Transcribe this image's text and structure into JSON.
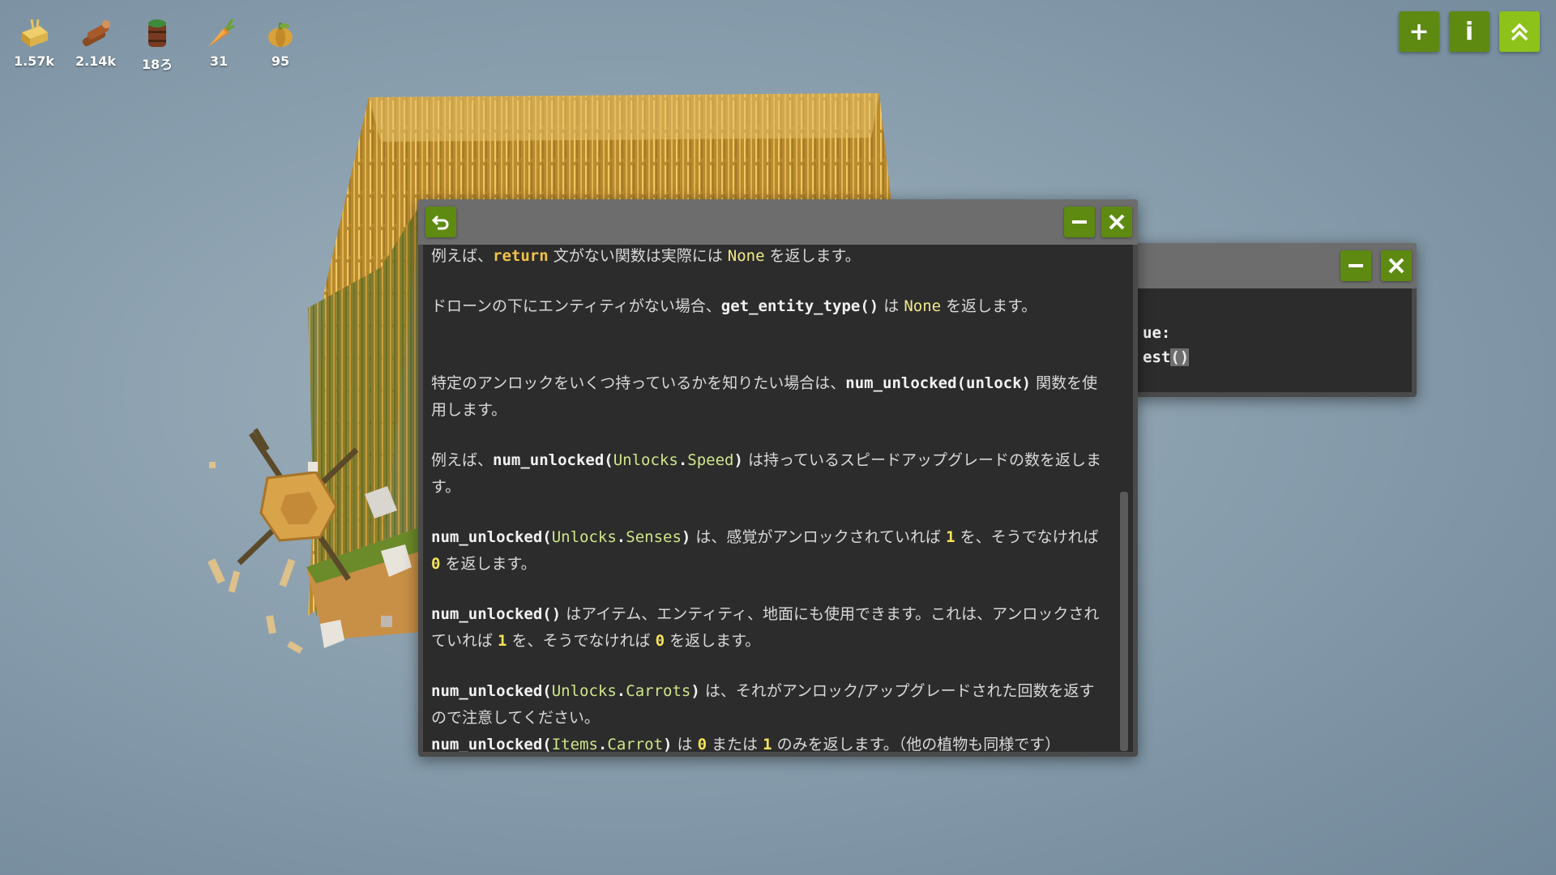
{
  "resources": [
    {
      "icon": "hay-icon",
      "count": "1.57k"
    },
    {
      "icon": "wood-icon",
      "count": "2.14k"
    },
    {
      "icon": "water-barrel-icon",
      "count": "18ろ"
    },
    {
      "icon": "carrot-icon",
      "count": "31"
    },
    {
      "icon": "pumpkin-icon",
      "count": "95"
    }
  ],
  "top_buttons": {
    "add": "+",
    "info": "i"
  },
  "doc": {
    "p1": {
      "a": "例えば、",
      "return_kw": "return",
      "b": " 文がない関数は実際には ",
      "none": "None",
      "c": " を返します。"
    },
    "p2": {
      "a": "ドローンの下にエンティティがない場合、",
      "fn": "get_entity_type()",
      "b": " は ",
      "none": "None",
      "c": " を返します。"
    },
    "p3": {
      "a": "特定のアンロックをいくつ持っているかを知りたい場合は、",
      "fn": "num_unlocked(",
      "arg": "unlock",
      "close": ")",
      "b": " 関数を使用します。"
    },
    "p4": {
      "a": "例えば、",
      "fn": "num_unlocked(",
      "ns": "Unlocks",
      "dot": ".",
      "arg": "Speed",
      "close": ")",
      "b": " は持っているスピードアップグレードの数を返します。"
    },
    "p5": {
      "fn": "num_unlocked(",
      "ns": "Unlocks",
      "dot": ".",
      "arg": "Senses",
      "close": ")",
      "a": " は、感覚がアンロックされていれば ",
      "one": "1",
      "b": " を、そうでなければ ",
      "zero": "0",
      "c": " を返します。"
    },
    "p6": {
      "fn": "num_unlocked()",
      "a": " はアイテム、エンティティ、地面にも使用できます。これは、アンロックされていれば ",
      "one": "1",
      "b": " を、そうでなければ ",
      "zero": "0",
      "c": " を返します。"
    },
    "p7": {
      "fn": "num_unlocked(",
      "ns": "Unlocks",
      "dot": ".",
      "arg": "Carrots",
      "close": ")",
      "a": " は、それがアンロック/アップグレードされた回数を返すので注意してください。"
    },
    "p8": {
      "fn": "num_unlocked(",
      "ns": "Items",
      "dot": ".",
      "arg": "Carrot",
      "close": ")",
      "a": " は ",
      "zero": "0",
      "b": " または ",
      "one": "1",
      "c": " のみを返します。（他の植物も同様です）"
    }
  },
  "back_code": {
    "line1": "ue:",
    "line2a": "est",
    "line2b": "()"
  },
  "colors": {
    "button_green": "#5e8a12",
    "accent_green": "#8cc21a",
    "keyword_yellow": "#f0c24a",
    "identifier_green": "#cfe68a"
  }
}
